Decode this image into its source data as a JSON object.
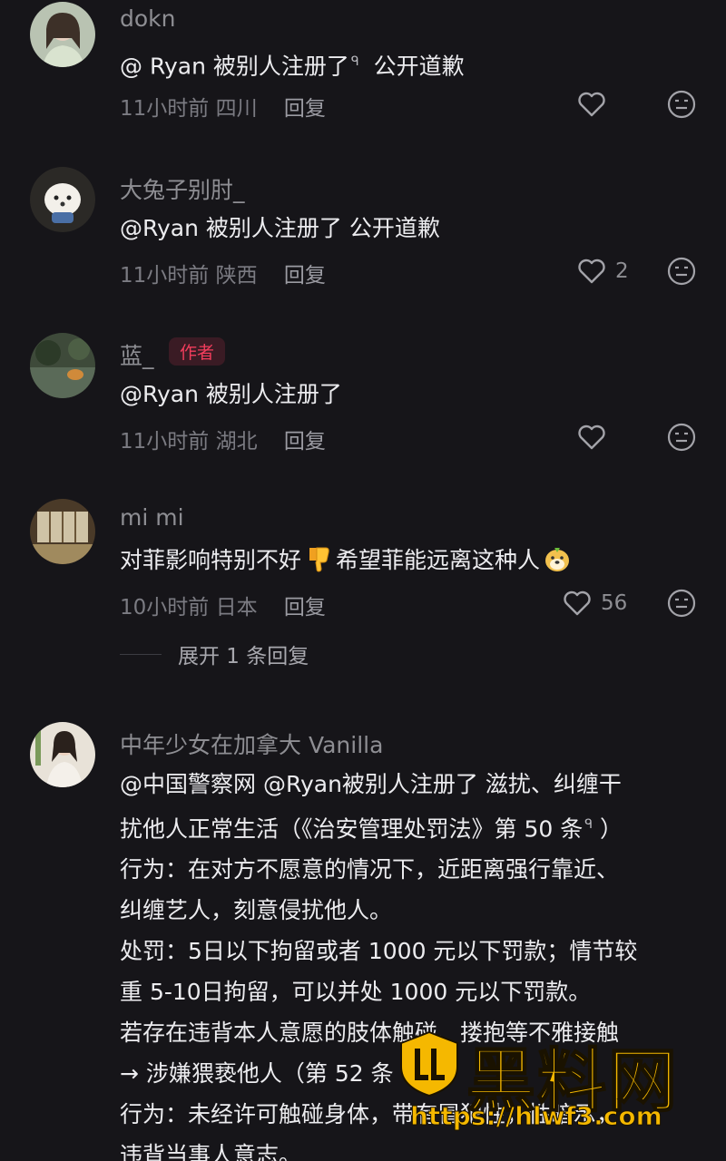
{
  "comments": [
    {
      "username": "dokn",
      "text": "@ Ryan 被别人注册了",
      "text_suffix": "公开道歉",
      "has_search_mark": true,
      "time": "11小时前",
      "location": "四川",
      "reply_label": "回复",
      "likes": ""
    },
    {
      "username": "大兔子别肘_",
      "text": "@Ryan 被别人注册了 公开道歉",
      "time": "11小时前",
      "location": "陕西",
      "reply_label": "回复",
      "likes": "2"
    },
    {
      "username": "蓝_",
      "badge": "作者",
      "text": "@Ryan 被别人注册了",
      "time": "11小时前",
      "location": "湖北",
      "reply_label": "回复",
      "likes": ""
    },
    {
      "username": "mi mi",
      "text_part1": "对菲影响特别不好",
      "emoji1": "thumbs-down-emoji",
      "text_part2": "希望菲能远离这种人",
      "emoji2": "dog-emoji",
      "time": "10小时前",
      "location": "日本",
      "reply_label": "回复",
      "likes": "56",
      "expand_replies": "展开 1 条回复"
    },
    {
      "username": "中年少女在加拿大 Vanilla",
      "lines": [
        "@中国警察网 @Ryan被别人注册了 滋扰、纠缠干",
        "扰他人正常生活（《治安管理处罚法》第 50 条",
        " 行为：在对方不愿意的情况下，近距离强行靠近、",
        "纠缠艺人，刻意侵扰他人。",
        "处罚：5日以下拘留或者 1000 元以下罚款；情节较",
        "重 5-10日拘留，可以并处 1000 元以下罚款。",
        " 若存在违背本人意愿的肢体触碰、搂抱等不雅接触",
        "→ 涉嫌猥亵他人（第 52 条",
        " 行为：未经许可触碰身体，带有冒犯性，性暗示，",
        "违背当事人意志。"
      ],
      "line2_suffix": "）"
    }
  ],
  "watermark": {
    "text": "黑料网",
    "url": "https://hlwf3.com"
  },
  "colors": {
    "background": "#161519",
    "author_badge": "#f23d5c",
    "watermark": "#f5b800"
  }
}
